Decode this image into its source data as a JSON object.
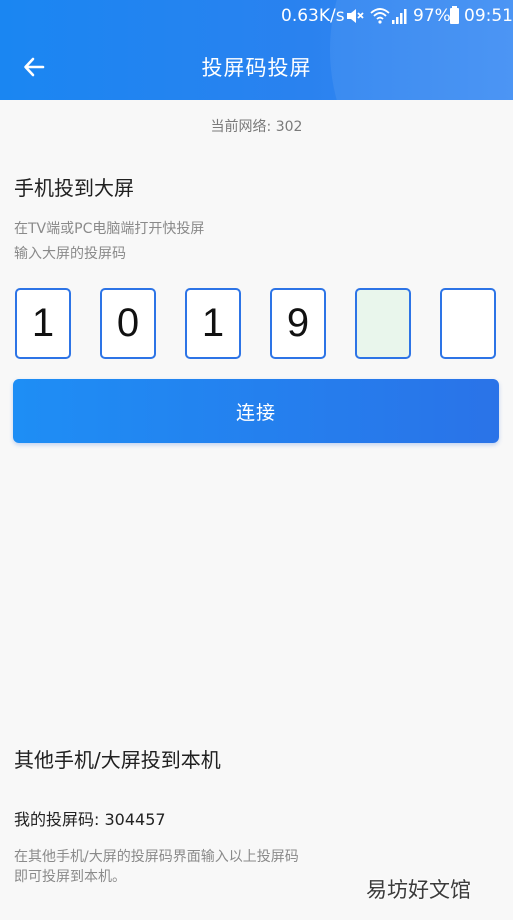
{
  "status_bar": {
    "net_speed": "0.63K/s",
    "battery": "97%",
    "time": "09:51"
  },
  "header": {
    "title": "投屏码投屏",
    "back_icon": "arrow-left-icon"
  },
  "network": {
    "label": "当前网络: 302"
  },
  "cast_to_screen": {
    "title": "手机投到大屏",
    "hint_line1": "在TV端或PC电脑端打开快投屏",
    "hint_line2": "输入大屏的投屏码",
    "code_digits": [
      "1",
      "0",
      "1",
      "9",
      "",
      ""
    ],
    "active_index": 4,
    "connect_label": "连接"
  },
  "receive": {
    "title": "其他手机/大屏投到本机",
    "my_code": "我的投屏码: 304457",
    "hint_line1": "在其他手机/大屏的投屏码界面输入以上投屏码",
    "hint_line2": "即可投屏到本机。"
  },
  "watermark": "易坊好文馆",
  "colors": {
    "primary": "#2a82ef",
    "box_border": "#2d74e6",
    "active_box": "#e9f6ec"
  }
}
